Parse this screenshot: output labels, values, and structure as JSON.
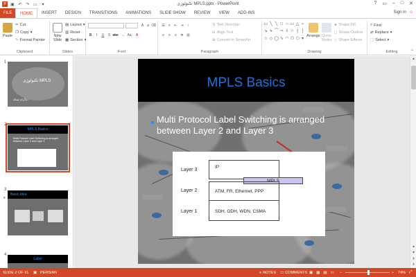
{
  "window": {
    "title": "تكنولوژی MPLS.pptx - PowerPoint",
    "controls": [
      "?",
      "▭",
      "–",
      "□",
      "✕"
    ]
  },
  "tabs": {
    "file": "FILE",
    "items": [
      "HOME",
      "INSERT",
      "DESIGN",
      "TRANSITIONS",
      "ANIMATIONS",
      "SLIDE SHOW",
      "REVIEW",
      "VIEW",
      "ADD-INS"
    ],
    "active_index": 0,
    "signin": "Sign in"
  },
  "ribbon": {
    "clipboard": {
      "paste": "Paste",
      "cut": "Cut",
      "copy": "Copy",
      "format_painter": "Format Painter",
      "label": "Clipboard"
    },
    "slides": {
      "new_slide": "New Slide",
      "layout": "Layout",
      "reset": "Reset",
      "section": "Section",
      "label": "Slides"
    },
    "font": {
      "label": "Font"
    },
    "paragraph": {
      "text_direction": "Text Direction",
      "align_text": "Align Text",
      "convert_smartart": "Convert to SmartArt",
      "label": "Paragraph"
    },
    "drawing": {
      "arrange": "Arrange",
      "quick_styles": "Quick Styles",
      "shape_fill": "Shape Fill",
      "shape_outline": "Shape Outline",
      "shape_effects": "Shape Effects",
      "label": "Drawing"
    },
    "editing": {
      "find": "Find",
      "replace": "Replace",
      "select": "Select",
      "label": "Editing"
    }
  },
  "thumbnails": [
    {
      "number": "1",
      "title": "تکنولوژی MPLS",
      "subtitle": "دیاگرام شبکه"
    },
    {
      "number": "2",
      "title": "MPLS Basics",
      "subtitle": "Multi Protocol Label Switching is arranged between Layer 2 and Layer 3"
    },
    {
      "number": "3",
      "title": "Basic Idea",
      "subtitle": ""
    },
    {
      "number": "4",
      "title": "Label",
      "subtitle": ""
    }
  ],
  "slide": {
    "title": "MPLS Basics",
    "bullet": "Multi Protocol Label Switching is arranged between Layer 2 and Layer 3",
    "layers": [
      {
        "label": "Layer 3",
        "content": "IP"
      },
      {
        "label": "Layer 2",
        "content": "ATM, FR, Ethernet, PPP"
      },
      {
        "label": "Layer 1",
        "content": "SDH, ODH, WDN, CSMA"
      }
    ],
    "mpls_label": "MPLS",
    "title_color": "#1e73d6",
    "bullet_color": "#2a8cff"
  },
  "status": {
    "slide_info": "SLIDE 2 OF 31",
    "language": "PERSIAN",
    "notes": "NOTES",
    "comments": "COMMENTS",
    "zoom": "74%",
    "accent": "#d24726"
  }
}
